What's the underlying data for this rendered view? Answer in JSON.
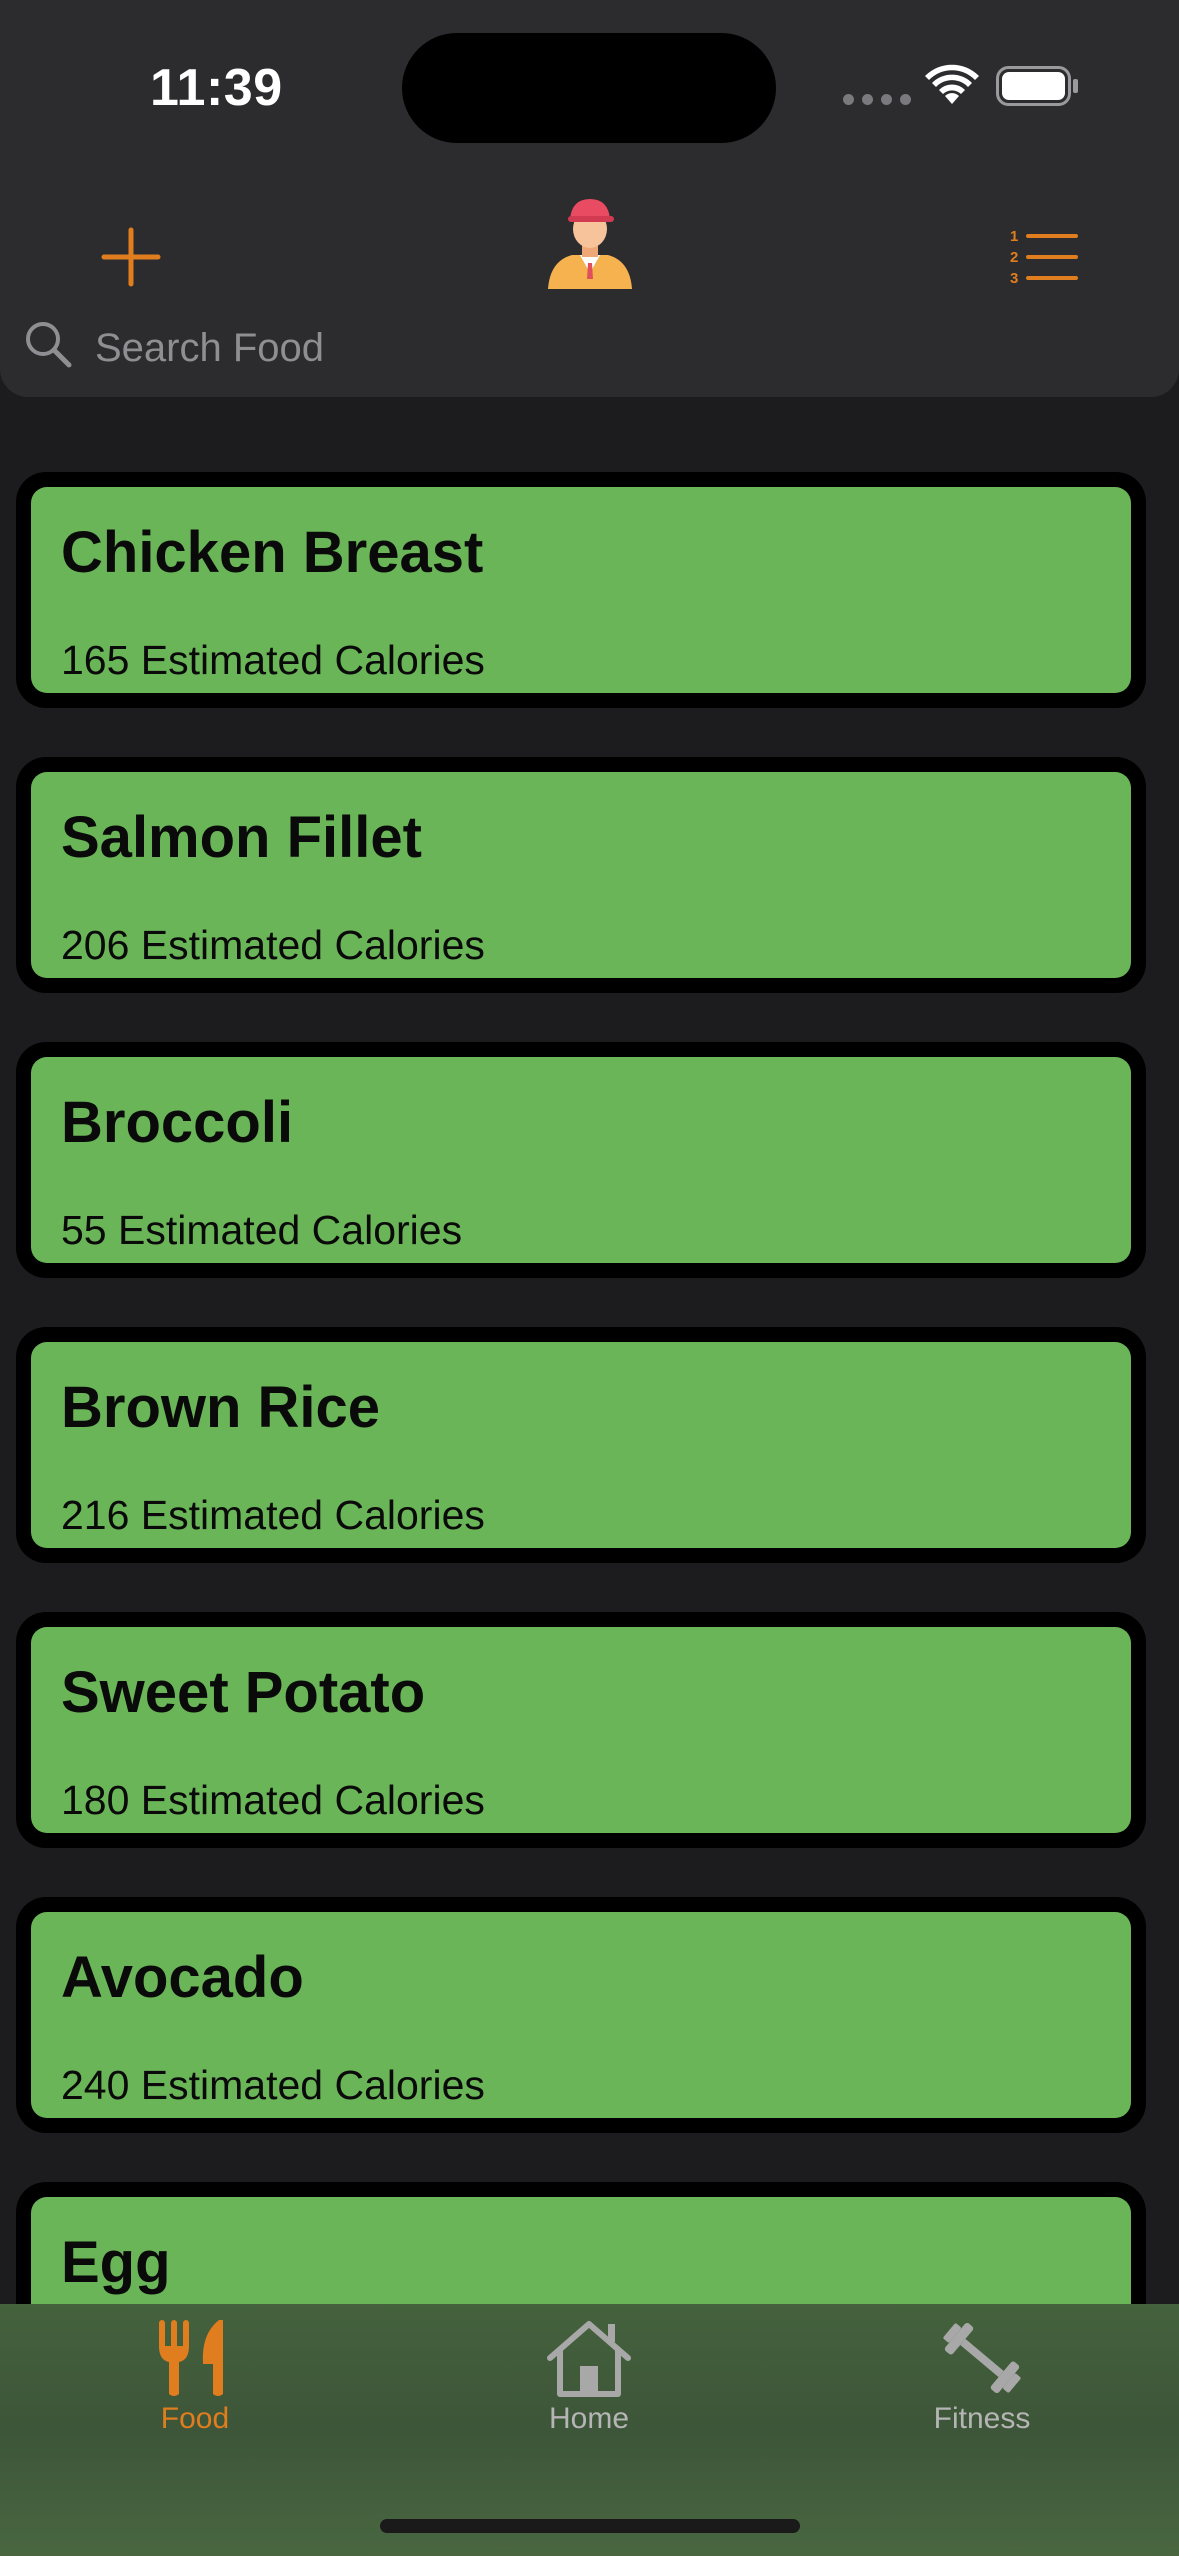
{
  "status_bar": {
    "time": "11:39"
  },
  "header": {
    "add_icon": "plus-icon",
    "avatar_icon": "person-avatar-icon",
    "list_icon": "numbered-list-icon",
    "accent_color": "#e07d1e"
  },
  "search": {
    "placeholder": "Search Food",
    "value": ""
  },
  "foods": [
    {
      "name": "Chicken Breast",
      "calories": "165 Estimated Calories"
    },
    {
      "name": "Salmon Fillet",
      "calories": "206 Estimated Calories"
    },
    {
      "name": "Broccoli",
      "calories": "55 Estimated Calories"
    },
    {
      "name": "Brown Rice",
      "calories": "216 Estimated Calories"
    },
    {
      "name": "Sweet Potato",
      "calories": "180 Estimated Calories"
    },
    {
      "name": "Avocado",
      "calories": "240 Estimated Calories"
    },
    {
      "name": "Egg",
      "calories": ""
    }
  ],
  "card_color": "#6ab557",
  "tabs": [
    {
      "label": "Food",
      "icon": "fork-knife-icon",
      "active": true
    },
    {
      "label": "Home",
      "icon": "house-icon",
      "active": false
    },
    {
      "label": "Fitness",
      "icon": "dumbbell-icon",
      "active": false
    }
  ]
}
